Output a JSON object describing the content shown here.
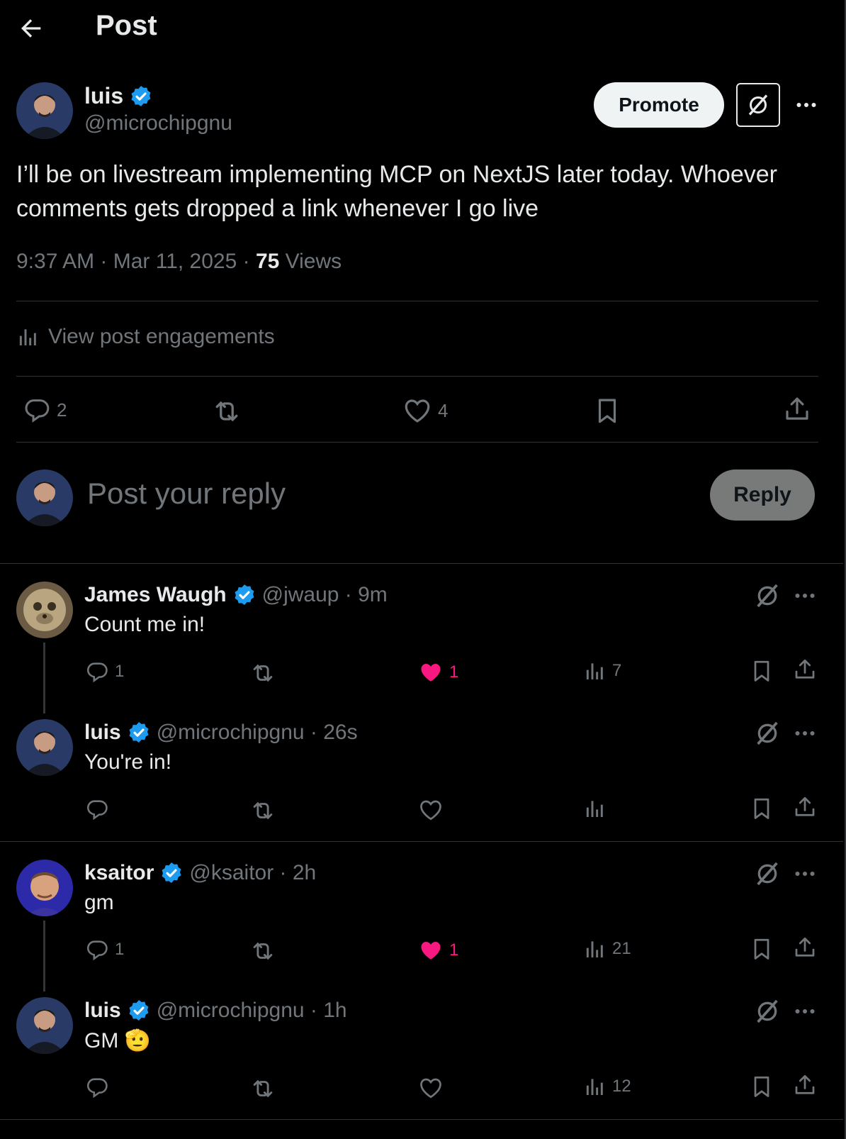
{
  "header": {
    "title": "Post"
  },
  "post": {
    "author_name": "luis",
    "author_handle": "@microchipgnu",
    "promote_label": "Promote",
    "text": "I’ll be on livestream implementing MCP on NextJS later today. Whoever comments gets dropped a link whenever I go live",
    "time": "9:37 AM · Mar 11, 2025 · ",
    "views_count": "75",
    "views_label": " Views",
    "engagements_label": "View post engagements",
    "reply_count": "2",
    "like_count": "4"
  },
  "composer": {
    "placeholder": "Post your reply",
    "reply_label": "Reply"
  },
  "comments": [
    {
      "name": "James Waugh",
      "handle": "@jwaup · 9m",
      "text": "Count me in!",
      "replies": "1",
      "likes": "1",
      "views": "7",
      "liked": true
    },
    {
      "name": "luis",
      "handle": "@microchipgnu · 26s",
      "text": "You're in!",
      "replies": "",
      "likes": "",
      "views": "",
      "liked": false
    },
    {
      "name": "ksaitor",
      "handle": "@ksaitor · 2h",
      "text": "gm",
      "replies": "1",
      "likes": "1",
      "views": "21",
      "liked": true
    },
    {
      "name": "luis",
      "handle": "@microchipgnu · 1h",
      "text": "GM 🫡",
      "replies": "",
      "likes": "",
      "views": "12",
      "liked": false
    }
  ],
  "colors": {
    "background": "#000000",
    "text": "#e7e9ea",
    "muted": "#71767b",
    "like": "#f91880",
    "verified": "#1d9bf0",
    "divider": "#2f3336"
  },
  "icons": [
    "back-arrow-icon",
    "verified-badge-icon",
    "grok-icon",
    "more-icon",
    "analytics-icon",
    "reply-icon",
    "repost-icon",
    "like-icon",
    "bookmark-icon",
    "share-icon"
  ]
}
